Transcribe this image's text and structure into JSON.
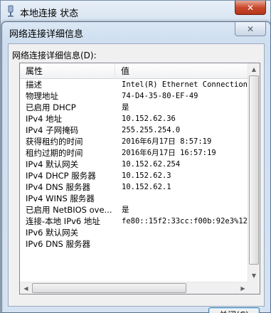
{
  "back_window": {
    "title": "本地连接 状态",
    "close_label": "✕"
  },
  "dialog": {
    "title": "网络连接详细信息",
    "close_label": "✕",
    "group_label": "网络连接详细信息(D):",
    "close_button_label": "关闭(C)"
  },
  "list": {
    "columns": [
      "属性",
      "值"
    ],
    "rows": [
      {
        "k": "描述",
        "v": "Intel(R) Ethernet Connection I"
      },
      {
        "k": "物理地址",
        "v": "74-D4-35-80-EF-49"
      },
      {
        "k": "已启用 DHCP",
        "v": "是"
      },
      {
        "k": "IPv4 地址",
        "v": "10.152.62.36"
      },
      {
        "k": "IPv4 子网掩码",
        "v": "255.255.254.0"
      },
      {
        "k": "获得租约的时间",
        "v": "2016年6月17日 8:57:19"
      },
      {
        "k": "租约过期的时间",
        "v": "2016年6月17日 16:57:19"
      },
      {
        "k": "IPv4 默认网关",
        "v": "10.152.62.254"
      },
      {
        "k": "IPv4 DHCP 服务器",
        "v": "10.152.62.3"
      },
      {
        "k": "IPv4 DNS 服务器",
        "v": "10.152.62.1"
      },
      {
        "k": "IPv4 WINS 服务器",
        "v": ""
      },
      {
        "k": "已启用 NetBIOS ove...",
        "v": "是"
      },
      {
        "k": "连接-本地 IPv6 地址",
        "v": "fe80::15f2:33cc:f00b:92e3%12"
      },
      {
        "k": "IPv6 默认网关",
        "v": ""
      },
      {
        "k": "IPv6 DNS 服务器",
        "v": ""
      }
    ]
  }
}
